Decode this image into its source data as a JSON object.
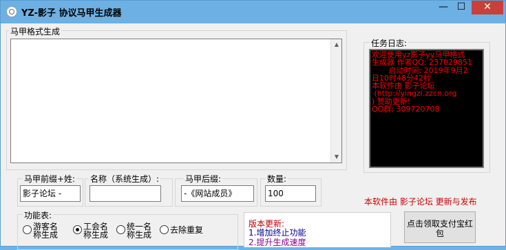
{
  "window": {
    "title": "YZ-影子 协议马甲生成器",
    "min_glyph": "—",
    "max_glyph": "☐",
    "close_glyph": "✕"
  },
  "format_group": {
    "label": "马甲格式生成"
  },
  "log": {
    "label": "任务日志:",
    "text": "欢迎使用yz影子yy马甲格式\n生成器 作者QQ: 237029851\n       启动时间: 2019年9月2\n日10时48分42秒\n本软件由 影子论坛\n (http://yingzi.zzcn.org\n) 赞助更新!\nQQ群: 309720708"
  },
  "prefix": {
    "label": "马甲前缀+姓:",
    "value": "影子论坛 -"
  },
  "name": {
    "label": "名称（系统生成）:",
    "value": ""
  },
  "suffix": {
    "label": "马甲后缀:",
    "value": "-《网站成员》"
  },
  "count": {
    "label": "数量:",
    "value": "100"
  },
  "credit": "本软件由 影子论坛 更新与发布",
  "functions": {
    "label": "功能表:",
    "options": [
      {
        "line1": "游客名",
        "line2": "称生成",
        "checked": false
      },
      {
        "line1": "工会名",
        "line2": "称生成",
        "checked": true
      },
      {
        "line1": "统一名",
        "line2": "称生成",
        "checked": false
      },
      {
        "line1": "去除重复",
        "line2": "",
        "checked": false
      }
    ]
  },
  "updates": {
    "title": "版本更新:",
    "items": [
      "1.增加终止功能",
      "2.提升生成速度"
    ],
    "colors": {
      "title": "#c00000",
      "item1": "#00008b",
      "item2": "#8b008b"
    }
  },
  "claim_button": {
    "line1": "点击领取支付宝红",
    "line2": "包"
  },
  "colors": {
    "titlebar": "#6db0e4",
    "close": "#c7413a",
    "log_text": "#ff0000",
    "credit": "#cc0000"
  }
}
